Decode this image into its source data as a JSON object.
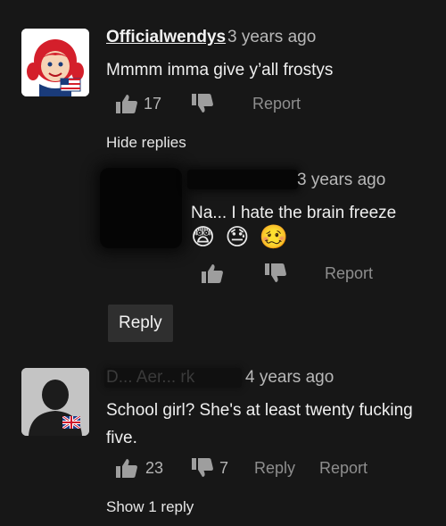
{
  "comments": [
    {
      "user": "Officialwendys",
      "time": "3 years ago",
      "text": "Mmmm imma give y’all frostys",
      "likes": "17",
      "report": "Report",
      "toggle_replies": "Hide replies"
    },
    {
      "time": "3 years ago",
      "text": "Na... I hate the brain freeze",
      "emojis": [
        "😨",
        "😓",
        "🥴"
      ],
      "report": "Report",
      "reply": "Reply"
    },
    {
      "user": "D... Aer... rk",
      "time": "4 years ago",
      "text_line1": "School girl? She's at least twenty fucking",
      "text_line2": "five.",
      "likes": "23",
      "dislikes": "7",
      "reply": "Reply",
      "report": "Report",
      "toggle_replies": "Show 1 reply"
    }
  ],
  "colors": {
    "background": "#171717",
    "button": "#2f2f2f",
    "wendys_red": "#d41f2b"
  }
}
